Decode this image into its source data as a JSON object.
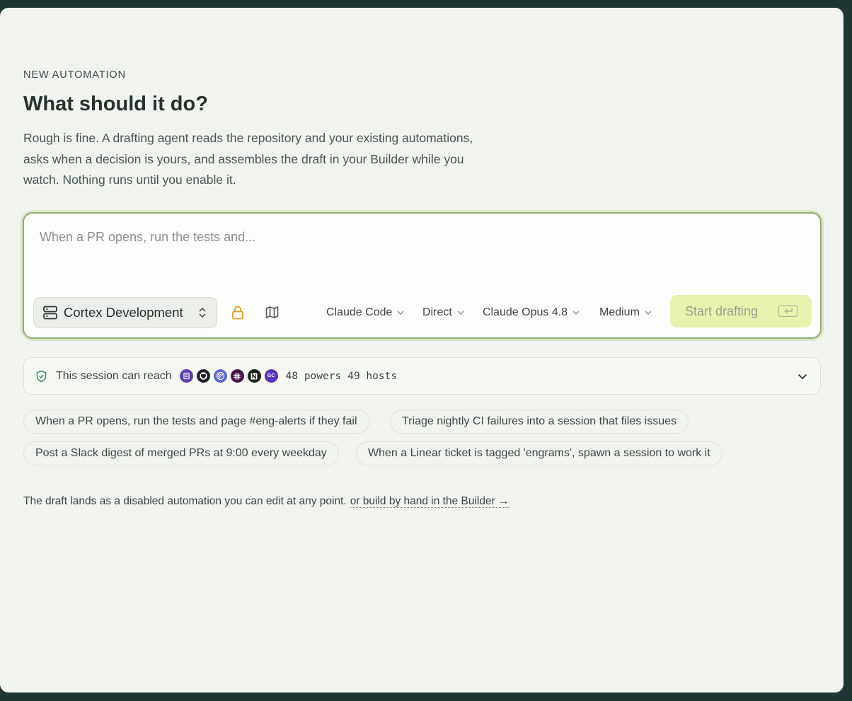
{
  "header": {
    "eyebrow": "NEW AUTOMATION",
    "title": "What should it do?",
    "description": "Rough is fine. A drafting agent reads the repository and your existing automations, asks when a decision is yours, and assembles the draft in your Builder while you watch. Nothing runs until you enable it."
  },
  "composer": {
    "placeholder": "When a PR opens, run the tests and...",
    "value": "",
    "workspace": "Cortex Development",
    "agent": "Claude Code",
    "mode": "Direct",
    "model": "Claude Opus 4.8",
    "effort": "Medium",
    "start_label": "Start drafting"
  },
  "reach": {
    "label": "This session can reach",
    "powers": "48 powers",
    "hosts": "49 hosts",
    "avatars": [
      {
        "icon": "mcp-server-icon",
        "color": "#5b3fb0"
      },
      {
        "icon": "github-icon",
        "color": "#1f2328"
      },
      {
        "icon": "linear-icon",
        "color": "#5e6ad2"
      },
      {
        "icon": "slack-icon",
        "color": "#4a154b"
      },
      {
        "icon": "notion-icon",
        "color": "#1f1f1f"
      },
      {
        "icon": "gc-icon",
        "color": "#5b35b5",
        "text": "GC"
      }
    ]
  },
  "suggestions": [
    "When a PR opens, run the tests and page #eng-alerts if they fail",
    "Triage nightly CI failures into a session that files issues",
    "Post a Slack digest of merged PRs at 9:00 every weekday",
    "When a Linear ticket is tagged 'engrams', spawn a session to work it"
  ],
  "footer": {
    "note": "The draft lands as a disabled automation you can edit at any point.",
    "link": "or build by hand in the Builder →"
  },
  "colors": {
    "background": "#1e3634",
    "panel": "#f1f4ee",
    "accent_border": "#8fac72",
    "start_button": "#e6f2ad",
    "lock_icon": "#d39a2a",
    "shield_icon": "#3f8a5c"
  }
}
